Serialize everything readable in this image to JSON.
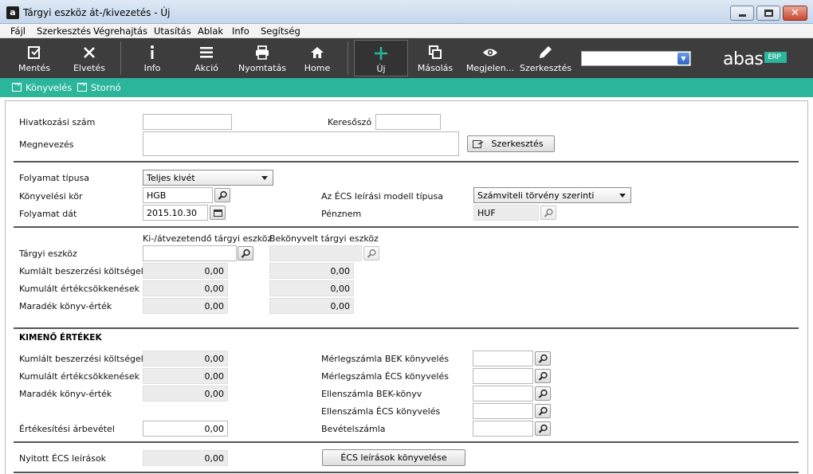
{
  "window": {
    "title": "Tárgyi eszköz át-/kivezetés - Új",
    "app_icon": "a"
  },
  "menu": [
    "Fájl",
    "Szerkesztés",
    "Végrehajtás",
    "Utasítás",
    "Ablak",
    "Info",
    "Segítség"
  ],
  "toolbar": {
    "buttons": [
      {
        "label": "Mentés",
        "icon": "save-icon"
      },
      {
        "label": "Elvetés",
        "icon": "close-icon"
      },
      {
        "label": "Info",
        "icon": "info-icon"
      },
      {
        "label": "Akció",
        "icon": "menu-icon"
      },
      {
        "label": "Nyomtatás",
        "icon": "printer-icon"
      },
      {
        "label": "Home",
        "icon": "home-icon"
      },
      {
        "label": "Új",
        "icon": "plus-icon"
      },
      {
        "label": "Másolás",
        "icon": "copy-icon"
      },
      {
        "label": "Megjelen...",
        "icon": "eye-icon"
      },
      {
        "label": "Szerkesztés",
        "icon": "pencil-icon"
      }
    ],
    "search_value": "",
    "logo_text": "abas",
    "logo_badge": "ERP"
  },
  "actions": [
    "Könyvelés",
    "Stornó"
  ],
  "form": {
    "ref_number_label": "Hivatkozási szám",
    "ref_number_value": "",
    "keyword_label": "Keresőszó",
    "keyword_value": "",
    "name_label": "Megnevezés",
    "name_value": "",
    "edit_button": "Szerkesztés",
    "process_type_label": "Folyamat típusa",
    "process_type_value": "Teljes kivét",
    "ledger_label": "Könyvelési kör",
    "ledger_value": "HGB",
    "process_date_label": "Folyamat dát",
    "process_date_value": "2015.10.30",
    "depr_model_label": "Az ÉCS leírási modell típusa",
    "depr_model_value": "Számviteli törvény szerinti",
    "currency_label": "Pénznem",
    "currency_value": "HUF",
    "col_outgoing": "Ki-/átvezetendő tárgyi eszköz",
    "col_incoming": "Bekönyvelt tárgyi eszköz",
    "asset_label": "Tárgyi eszköz",
    "asset_out_value": "",
    "asset_in_value": "",
    "rows": [
      {
        "label": "Kumlált beszerzési költségek",
        "out": "0,00",
        "in": "0,00"
      },
      {
        "label": "Kumulált értékcsökkenések",
        "out": "0,00",
        "in": "0,00"
      },
      {
        "label": "Maradék könyv-érték",
        "out": "0,00",
        "in": "0,00"
      }
    ],
    "outgoing_title": "KIMENŐ ÉRTÉKEK",
    "out_rows": [
      {
        "label": "Kumlált beszerzési költségek",
        "value": "0,00"
      },
      {
        "label": "Kumulált értékcsökkenések",
        "value": "0,00"
      },
      {
        "label": "Maradék könyv-érték",
        "value": "0,00"
      }
    ],
    "sales_revenue_label": "Értékesítési árbevétel",
    "sales_revenue_value": "0,00",
    "accounts": [
      {
        "label": "Mérlegszámla BEK könyvelés",
        "value": ""
      },
      {
        "label": "Mérlegszámla ÉCS könyvelés",
        "value": ""
      },
      {
        "label": "Ellenszámla BEK-könyv",
        "value": ""
      },
      {
        "label": "Ellenszámla ÉCS könyvelés",
        "value": ""
      },
      {
        "label": "Bevételszámla",
        "value": ""
      }
    ],
    "open_depr_label": "Nyitott ÉCS leírások",
    "open_depr_value": "0,00",
    "post_depr_button": "ÉCS leírások könyvelése"
  }
}
